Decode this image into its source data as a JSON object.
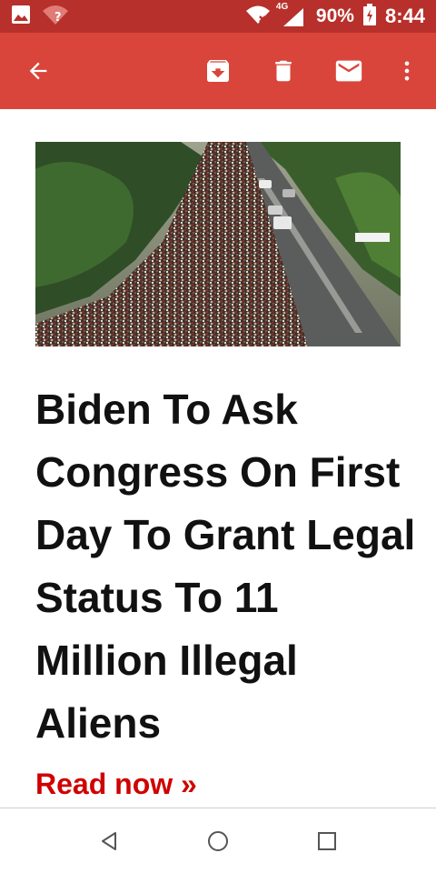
{
  "status_bar": {
    "battery": "90%",
    "time": "8:44",
    "network": "4G",
    "icons": [
      "image-icon",
      "wifi-question-icon",
      "wifi-off-icon",
      "signal-icon",
      "battery-charging-icon"
    ]
  },
  "app_bar": {
    "icons": [
      "back-arrow-icon",
      "archive-icon",
      "delete-icon",
      "mail-icon",
      "more-vert-icon"
    ]
  },
  "article": {
    "headline": "Biden To Ask Congress On First Day To Grant Legal Status To 11 Million Illegal Aliens",
    "link_text": "Read now »"
  },
  "nav_bar": {
    "icons": [
      "nav-back-icon",
      "nav-home-icon",
      "nav-recents-icon"
    ]
  },
  "colors": {
    "status_bar": "#b7302b",
    "app_bar": "#d9453b",
    "link": "#d00000"
  }
}
